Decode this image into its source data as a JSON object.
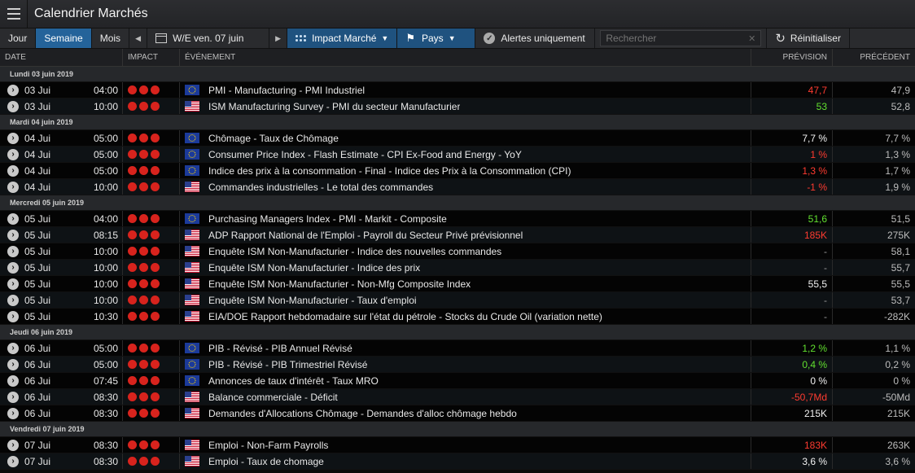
{
  "app": {
    "title": "Calendrier Marchés"
  },
  "toolbar": {
    "view_day": "Jour",
    "view_week": "Semaine",
    "view_month": "Mois",
    "week_label": "W/E ven. 07 juin",
    "impact_label": "Impact Marché",
    "country_label": "Pays",
    "alerts_label": "Alertes uniquement",
    "search_placeholder": "Rechercher",
    "reset_label": "Réinitialiser"
  },
  "columns": {
    "date": "DATE",
    "impact": "IMPACT",
    "event": "ÉVÉNEMENT",
    "forecast": "PRÉVISION",
    "previous": "PRÉCÉDENT"
  },
  "colors": {
    "accent": "#24639a",
    "impact": "#d8231d",
    "negative": "#ff3b30",
    "positive": "#62e02f"
  },
  "groups": [
    {
      "label": "Lundi 03 juin 2019",
      "rows": [
        {
          "day": "03 Jui",
          "time": "04:00",
          "flag": "eu",
          "event": "PMI - Manufacturing - PMI Industriel",
          "forecast": "47,7",
          "fc_color": "red",
          "previous": "47,9"
        },
        {
          "day": "03 Jui",
          "time": "10:00",
          "flag": "us",
          "event": "ISM Manufacturing Survey - PMI du secteur Manufacturier",
          "forecast": "53",
          "fc_color": "green",
          "previous": "52,8"
        }
      ]
    },
    {
      "label": "Mardi 04 juin 2019",
      "rows": [
        {
          "day": "04 Jui",
          "time": "05:00",
          "flag": "eu",
          "event": "Chômage - Taux de Chômage",
          "forecast": "7,7 %",
          "fc_color": "white",
          "previous": "7,7 %"
        },
        {
          "day": "04 Jui",
          "time": "05:00",
          "flag": "eu",
          "event": "Consumer Price Index - Flash Estimate - CPI Ex-Food and Energy - YoY",
          "forecast": "1 %",
          "fc_color": "red",
          "previous": "1,3 %"
        },
        {
          "day": "04 Jui",
          "time": "05:00",
          "flag": "eu",
          "event": "Indice des prix à la consommation - Final - Indice des Prix à la Consommation (CPI)",
          "forecast": "1,3 %",
          "fc_color": "red",
          "previous": "1,7 %"
        },
        {
          "day": "04 Jui",
          "time": "10:00",
          "flag": "us",
          "event": "Commandes industrielles - Le total des commandes",
          "forecast": "-1 %",
          "fc_color": "red",
          "previous": "1,9 %"
        }
      ]
    },
    {
      "label": "Mercredi 05 juin 2019",
      "rows": [
        {
          "day": "05 Jui",
          "time": "04:00",
          "flag": "eu",
          "event": "Purchasing Managers Index - PMI - Markit - Composite",
          "forecast": "51,6",
          "fc_color": "green",
          "previous": "51,5"
        },
        {
          "day": "05 Jui",
          "time": "08:15",
          "flag": "us",
          "event": "ADP Rapport National de l'Emploi - Payroll du Secteur Privé prévisionnel",
          "forecast": "185K",
          "fc_color": "red",
          "previous": "275K"
        },
        {
          "day": "05 Jui",
          "time": "10:00",
          "flag": "us",
          "event": "Enquête ISM Non-Manufacturier - Indice des nouvelles commandes",
          "forecast": "-",
          "fc_color": "dash",
          "previous": "58,1"
        },
        {
          "day": "05 Jui",
          "time": "10:00",
          "flag": "us",
          "event": "Enquête ISM Non-Manufacturier - Indice des prix",
          "forecast": "-",
          "fc_color": "dash",
          "previous": "55,7"
        },
        {
          "day": "05 Jui",
          "time": "10:00",
          "flag": "us",
          "event": "Enquête ISM Non-Manufacturier - Non-Mfg Composite Index",
          "forecast": "55,5",
          "fc_color": "white",
          "previous": "55,5"
        },
        {
          "day": "05 Jui",
          "time": "10:00",
          "flag": "us",
          "event": "Enquête ISM Non-Manufacturier - Taux d'emploi",
          "forecast": "-",
          "fc_color": "dash",
          "previous": "53,7"
        },
        {
          "day": "05 Jui",
          "time": "10:30",
          "flag": "us",
          "event": "EIA/DOE Rapport hebdomadaire sur l'état du pétrole - Stocks du Crude Oil (variation nette)",
          "forecast": "-",
          "fc_color": "dash",
          "previous": "-282K"
        }
      ]
    },
    {
      "label": "Jeudi 06 juin 2019",
      "rows": [
        {
          "day": "06 Jui",
          "time": "05:00",
          "flag": "eu",
          "event": "PIB - Révisé - PIB Annuel Révisé",
          "forecast": "1,2 %",
          "fc_color": "green",
          "previous": "1,1 %"
        },
        {
          "day": "06 Jui",
          "time": "05:00",
          "flag": "eu",
          "event": "PIB - Révisé - PIB Trimestriel Révisé",
          "forecast": "0,4 %",
          "fc_color": "green",
          "previous": "0,2 %"
        },
        {
          "day": "06 Jui",
          "time": "07:45",
          "flag": "eu",
          "event": "Annonces de taux d'intérêt - Taux MRO",
          "forecast": "0 %",
          "fc_color": "white",
          "previous": "0 %"
        },
        {
          "day": "06 Jui",
          "time": "08:30",
          "flag": "us",
          "event": "Balance commerciale - Déficit",
          "forecast": "-50,7Md",
          "fc_color": "red",
          "previous": "-50Md"
        },
        {
          "day": "06 Jui",
          "time": "08:30",
          "flag": "us",
          "event": "Demandes d'Allocations Chômage - Demandes d'alloc chômage hebdo",
          "forecast": "215K",
          "fc_color": "white",
          "previous": "215K"
        }
      ]
    },
    {
      "label": "Vendredi 07 juin 2019",
      "rows": [
        {
          "day": "07 Jui",
          "time": "08:30",
          "flag": "us",
          "event": "Emploi - Non-Farm Payrolls",
          "forecast": "183K",
          "fc_color": "red",
          "previous": "263K"
        },
        {
          "day": "07 Jui",
          "time": "08:30",
          "flag": "us",
          "event": "Emploi - Taux de chomage",
          "forecast": "3,6 %",
          "fc_color": "white",
          "previous": "3,6 %"
        }
      ]
    }
  ]
}
